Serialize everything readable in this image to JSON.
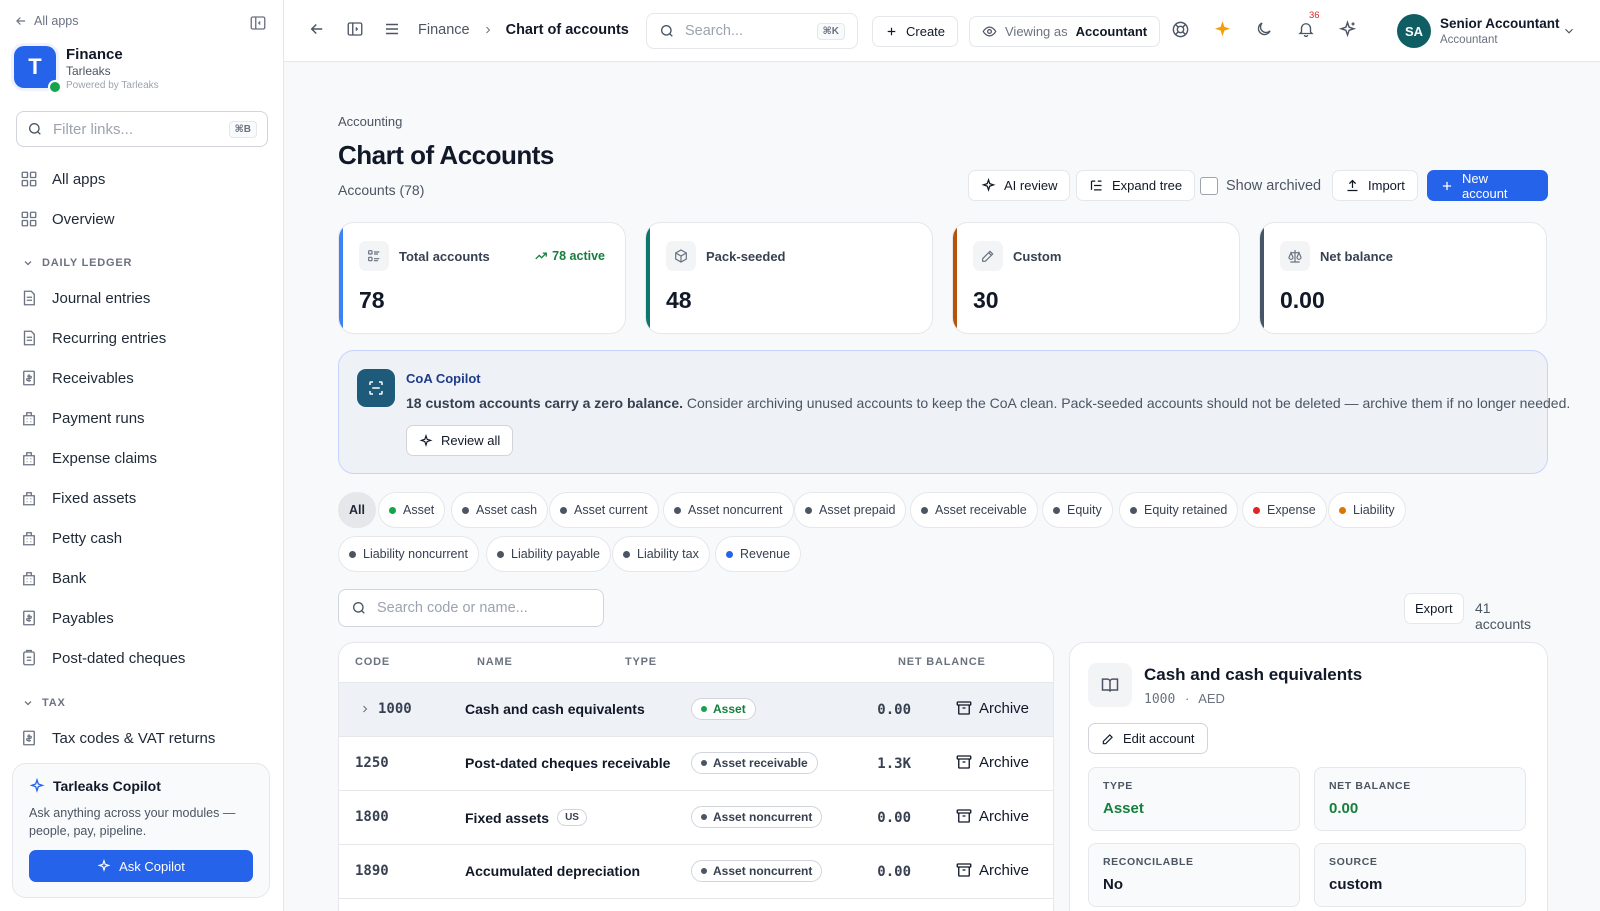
{
  "sidebar": {
    "back_label": "All apps",
    "app_name": "Finance",
    "org_name": "Tarleaks",
    "powered_by": "Powered by Tarleaks",
    "filter_placeholder": "Filter links...",
    "filter_shortcut": "⌘B",
    "top_items": [
      {
        "label": "All apps",
        "icon": "grid-icon"
      },
      {
        "label": "Overview",
        "icon": "grid-icon"
      }
    ],
    "sections": [
      {
        "title": "DAILY LEDGER",
        "items": [
          {
            "label": "Journal entries",
            "icon": "document-icon"
          },
          {
            "label": "Recurring entries",
            "icon": "document-icon"
          },
          {
            "label": "Receivables",
            "icon": "invoice-icon"
          },
          {
            "label": "Payment runs",
            "icon": "bank-icon"
          },
          {
            "label": "Expense claims",
            "icon": "bank-icon"
          },
          {
            "label": "Fixed assets",
            "icon": "bank-icon"
          },
          {
            "label": "Petty cash",
            "icon": "bank-icon"
          },
          {
            "label": "Bank",
            "icon": "bank-icon"
          },
          {
            "label": "Payables",
            "icon": "invoice-icon"
          },
          {
            "label": "Post-dated cheques",
            "icon": "clipboard-icon"
          }
        ]
      },
      {
        "title": "TAX",
        "items": [
          {
            "label": "Tax codes & VAT returns",
            "icon": "invoice-icon"
          }
        ]
      }
    ],
    "copilot": {
      "title": "Tarleaks Copilot",
      "description": "Ask anything across your modules — people, pay, pipeline.",
      "button": "Ask Copilot"
    }
  },
  "topbar": {
    "breadcrumb": [
      "Finance",
      "Chart of accounts"
    ],
    "search_placeholder": "Search...",
    "search_shortcut": "⌘K",
    "create_label": "Create",
    "viewing_as_prefix": "Viewing as",
    "viewing_as_role": "Accountant",
    "notification_count": "36",
    "user_initials": "SA",
    "user_name": "Senior Accountant",
    "user_role": "Accountant"
  },
  "page": {
    "eyebrow": "Accounting",
    "title": "Chart of Accounts",
    "subtitle": "Accounts (78)",
    "actions": {
      "ai_review": "AI review",
      "expand_tree": "Expand tree",
      "show_archived": "Show archived",
      "show_archived_checked": false,
      "import": "Import",
      "new_account": "New account"
    }
  },
  "stats": [
    {
      "label": "Total accounts",
      "value": "78",
      "trend": "78 active",
      "icon": "list-icon",
      "accent": "#3b82f6"
    },
    {
      "label": "Pack-seeded",
      "value": "48",
      "trend": "",
      "icon": "package-icon",
      "accent": "#0f766e"
    },
    {
      "label": "Custom",
      "value": "30",
      "trend": "",
      "icon": "pencil-icon",
      "accent": "#b45309"
    },
    {
      "label": "Net balance",
      "value": "0.00",
      "trend": "",
      "icon": "scale-icon",
      "accent": "#475569"
    }
  ],
  "copilot_banner": {
    "title": "CoA Copilot",
    "highlight": "18 custom accounts carry a zero balance.",
    "text": " Consider archiving unused accounts to keep the CoA clean. Pack-seeded accounts should not be deleted — archive them if no longer needed.",
    "button": "Review all"
  },
  "filters": {
    "active": "All",
    "chips": [
      {
        "label": "All",
        "color": ""
      },
      {
        "label": "Asset",
        "color": "#16a34a"
      },
      {
        "label": "Asset cash",
        "color": "#4b5563"
      },
      {
        "label": "Asset current",
        "color": "#4b5563"
      },
      {
        "label": "Asset noncurrent",
        "color": "#4b5563"
      },
      {
        "label": "Asset prepaid",
        "color": "#4b5563"
      },
      {
        "label": "Asset receivable",
        "color": "#4b5563"
      },
      {
        "label": "Equity",
        "color": "#4b5563"
      },
      {
        "label": "Equity retained",
        "color": "#4b5563"
      },
      {
        "label": "Expense",
        "color": "#dc2626"
      },
      {
        "label": "Liability",
        "color": "#d97706"
      },
      {
        "label": "Liability noncurrent",
        "color": "#4b5563"
      },
      {
        "label": "Liability payable",
        "color": "#4b5563"
      },
      {
        "label": "Liability tax",
        "color": "#4b5563"
      },
      {
        "label": "Revenue",
        "color": "#2563eb"
      }
    ]
  },
  "table": {
    "search_placeholder": "Search code or name...",
    "export_label": "Export",
    "count_label": "41 accounts",
    "columns": [
      "CODE",
      "NAME",
      "TYPE",
      "NET BALANCE"
    ],
    "rows": [
      {
        "code": "1000",
        "name": "Cash and cash equivalents",
        "tag": "",
        "type": "Asset",
        "type_color": "#16a34a",
        "balance": "0.00",
        "action": "Archive",
        "expandable": true
      },
      {
        "code": "1250",
        "name": "Post-dated cheques receivable",
        "tag": "",
        "type": "Asset receivable",
        "type_color": "#4b5563",
        "balance": "1.3K",
        "action": "Archive",
        "expandable": false
      },
      {
        "code": "1800",
        "name": "Fixed assets",
        "tag": "US",
        "type": "Asset noncurrent",
        "type_color": "#4b5563",
        "balance": "0.00",
        "action": "Archive",
        "expandable": false
      },
      {
        "code": "1890",
        "name": "Accumulated depreciation",
        "tag": "",
        "type": "Asset noncurrent",
        "type_color": "#4b5563",
        "balance": "0.00",
        "action": "Archive",
        "expandable": false
      }
    ]
  },
  "detail": {
    "title": "Cash and cash equivalents",
    "code": "1000",
    "separator": "·",
    "currency": "AED",
    "edit_label": "Edit account",
    "fields": [
      {
        "label": "TYPE",
        "value": "Asset",
        "green": true
      },
      {
        "label": "NET BALANCE",
        "value": "0.00",
        "green": true
      },
      {
        "label": "RECONCILABLE",
        "value": "No",
        "green": false
      },
      {
        "label": "SOURCE",
        "value": "custom",
        "green": false
      }
    ]
  }
}
